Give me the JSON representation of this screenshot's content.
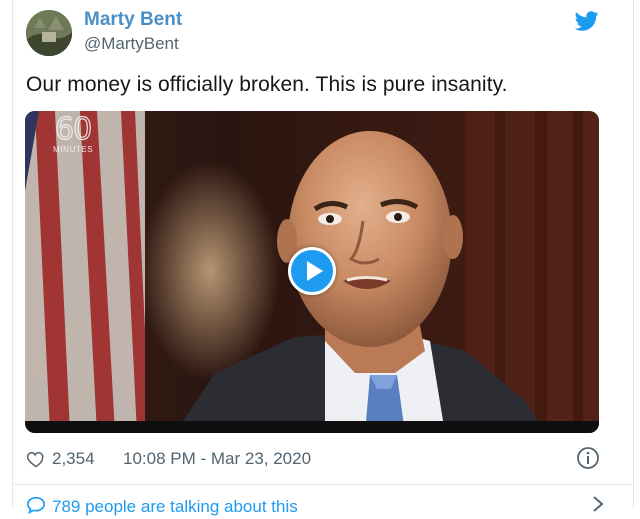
{
  "tweet": {
    "author_name": "Marty Bent",
    "author_handle": "@MartyBent",
    "text": "Our money is officially broken. This is pure insanity.",
    "likes": "2,354",
    "timestamp": "10:08 PM - Mar 23, 2020",
    "conversation_text": "789 people are talking about this"
  },
  "video": {
    "logo_number": "60",
    "logo_word": "MINUTES"
  },
  "icons": {
    "brand": "twitter-bird-icon",
    "like": "heart-icon",
    "info": "info-icon",
    "conversation": "chat-bubble-icon",
    "more": "chevron-right-icon",
    "play": "play-icon"
  },
  "colors": {
    "name": "#4a90c8",
    "accent": "#1d9bf0",
    "muted": "#536471",
    "border": "#e1e8ed"
  }
}
